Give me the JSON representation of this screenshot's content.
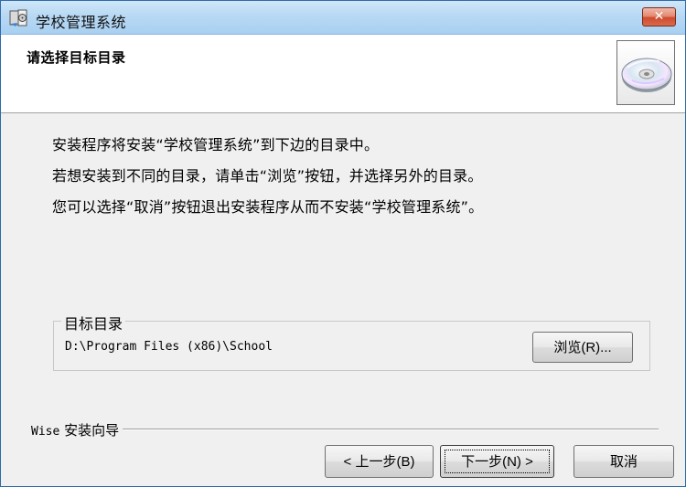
{
  "window": {
    "title": "学校管理系统",
    "close_label": "✕"
  },
  "header": {
    "title": "请选择目标目录",
    "image_icon": "cd-icon"
  },
  "instructions": [
    "安装程序将安装“学校管理系统”到下边的目录中。",
    "若想安装到不同的目录，请单击“浏览”按钮，并选择另外的目录。",
    "您可以选择“取消”按钮退出安装程序从而不安装“学校管理系统”。"
  ],
  "target": {
    "group_label": "目标目录",
    "path": "D:\\Program Files (x86)\\School",
    "browse_label": "浏览(R)..."
  },
  "footer": {
    "brand_prefix": "Wise",
    "brand_suffix": "安装向导",
    "back_label": "< 上一步(B)",
    "next_label": "下一步(N) >",
    "cancel_label": "取消"
  },
  "colors": {
    "titlebar": "#b8d9f4",
    "close_button": "#cf4b2f",
    "dialog_background": "#f0f0f0",
    "header_background": "#ffffff"
  }
}
